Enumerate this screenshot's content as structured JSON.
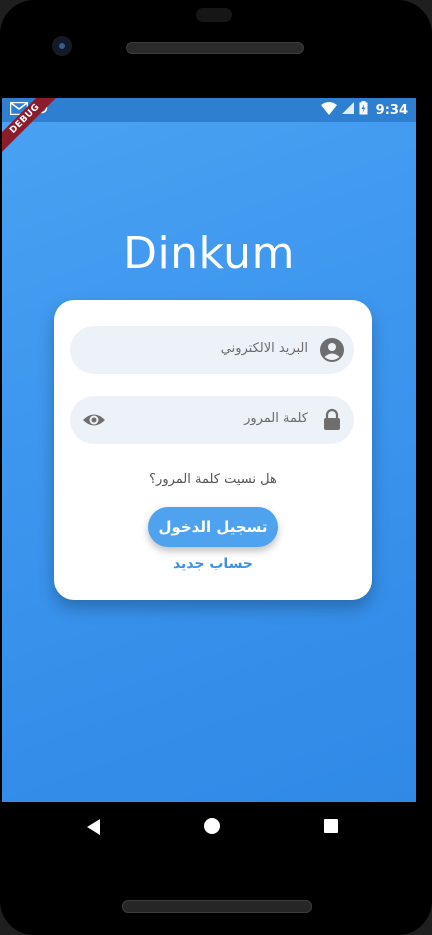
{
  "status_bar": {
    "time": "9:34",
    "debug_label": "DEBUG"
  },
  "app": {
    "title": "Dinkum"
  },
  "login_form": {
    "email_placeholder": "البريد الالكتروني",
    "password_placeholder": "كلمة المرور",
    "forgot_password": "هل نسيت كلمة المرور؟",
    "login_button": "تسجيل الدخول",
    "create_account": "حساب جديد"
  },
  "icons": {
    "email_field": "account-circle-icon",
    "password_field": "lock-icon",
    "password_visibility": "eye-icon"
  },
  "colors": {
    "background_top": "#4aa2f2",
    "background_bottom": "#2f89e6",
    "button": "#4fa3ee",
    "link": "#3d91e3",
    "field_background": "#edf2f9"
  }
}
